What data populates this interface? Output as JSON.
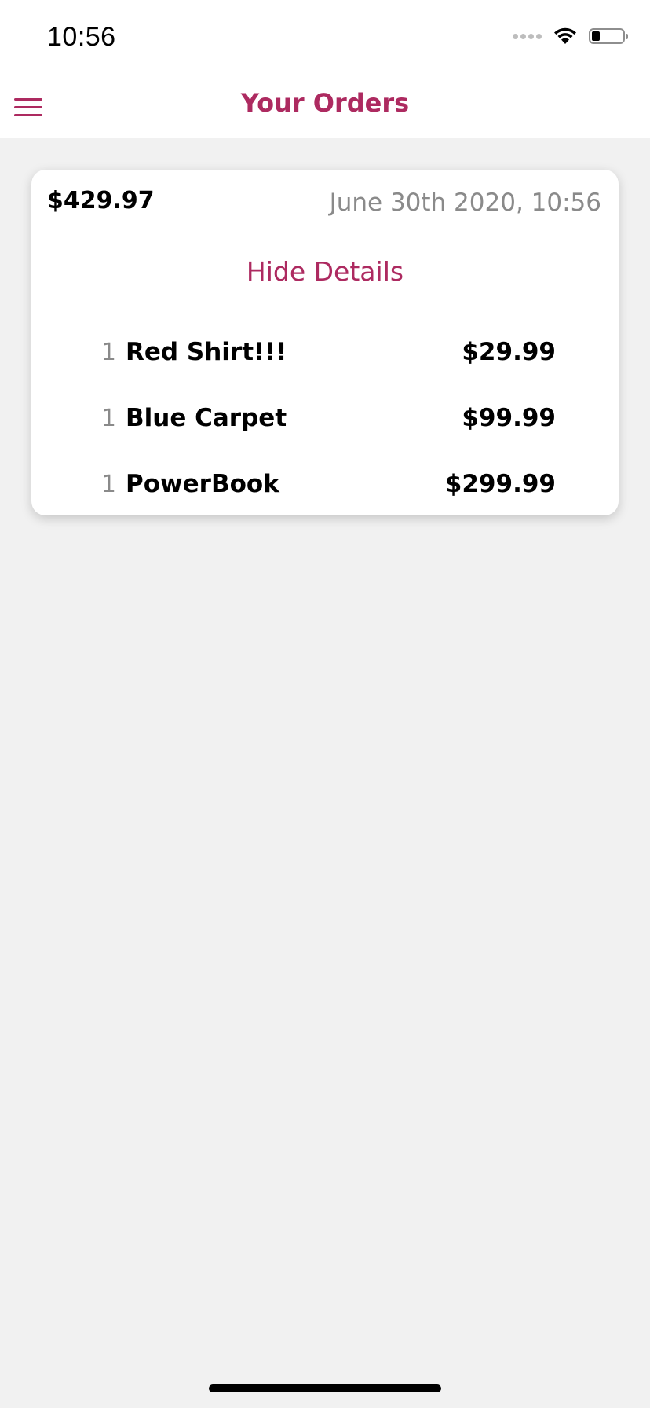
{
  "status_bar": {
    "time": "10:56",
    "icons": [
      "cellular-signal-icon",
      "wifi-icon",
      "battery-icon"
    ]
  },
  "header": {
    "title": "Your Orders",
    "menu_icon": "hamburger-menu-icon",
    "accent_color": "#ad2a60"
  },
  "order": {
    "total": "$429.97",
    "date": "June 30th 2020, 10:56",
    "toggle_label": "Hide Details",
    "items": [
      {
        "qty": "1",
        "name": "Red Shirt!!!",
        "price": "$29.99"
      },
      {
        "qty": "1",
        "name": "Blue Carpet",
        "price": "$99.99"
      },
      {
        "qty": "1",
        "name": "PowerBook",
        "price": "$299.99"
      }
    ]
  }
}
